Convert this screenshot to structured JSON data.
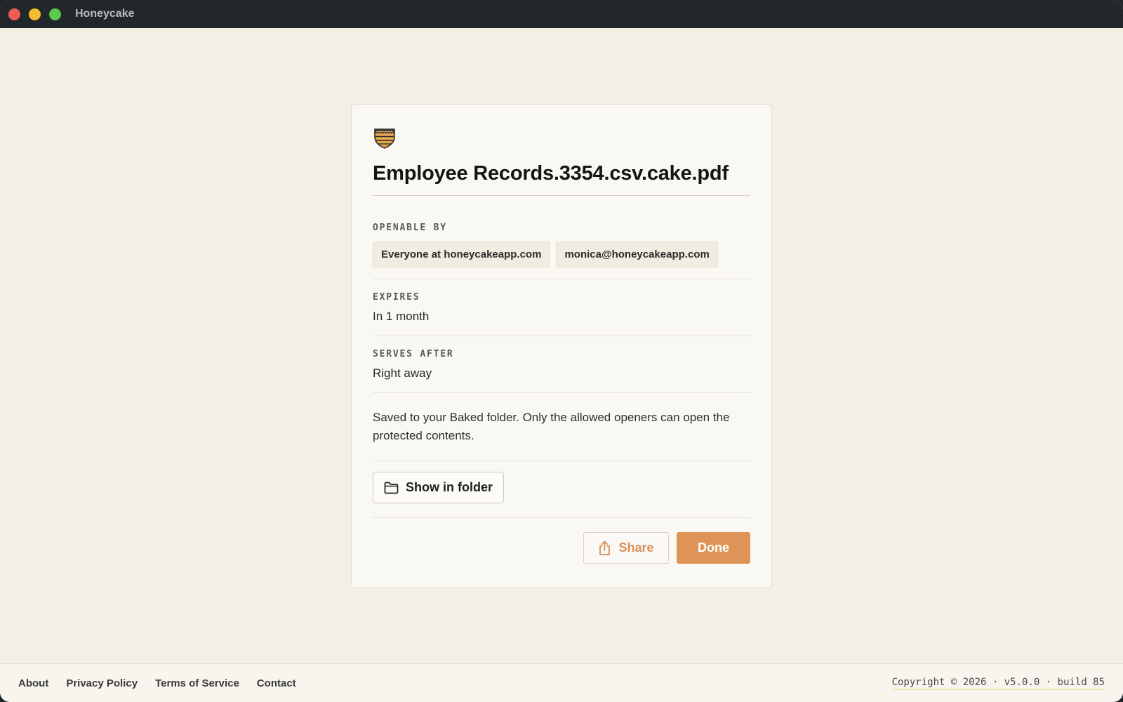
{
  "window": {
    "title": "Honeycake"
  },
  "card": {
    "logo_icon": "honeycake-shield-icon",
    "file_name": "Employee Records.3354.csv.cake.pdf",
    "openable_by": {
      "label": "OPENABLE BY",
      "chips": [
        "Everyone at honeycakeapp.com",
        "monica@honeycakeapp.com"
      ]
    },
    "expires": {
      "label": "EXPIRES",
      "value": "In 1 month"
    },
    "serves_after": {
      "label": "SERVES AFTER",
      "value": "Right away"
    },
    "note": "Saved to your Baked folder. Only the allowed openers can open the protected contents.",
    "show_in_folder_label": "Show in folder",
    "share_label": "Share",
    "done_label": "Done"
  },
  "footer": {
    "links": [
      "About",
      "Privacy Policy",
      "Terms of Service",
      "Contact"
    ],
    "copyright": "Copyright © 2026 · v5.0.0 · build 85"
  },
  "colors": {
    "accent": "#de9456",
    "background": "#f3efe5",
    "titlebar": "#22272b"
  }
}
